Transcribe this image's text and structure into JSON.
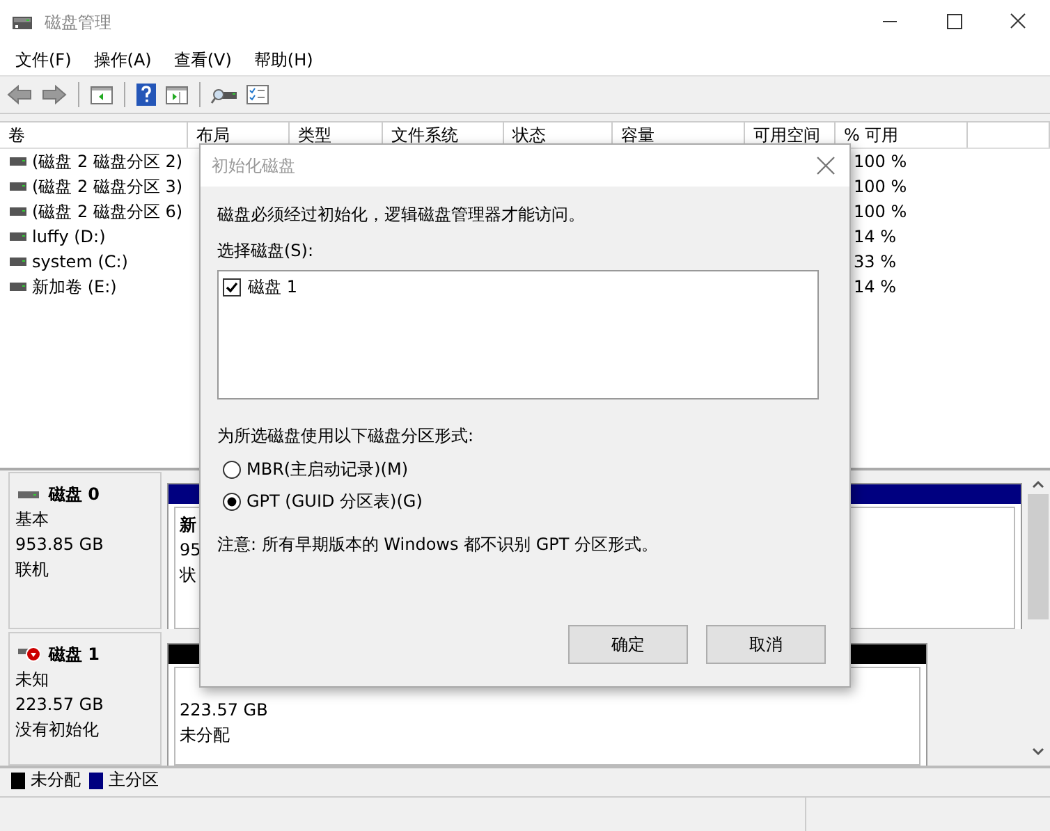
{
  "window": {
    "title": "磁盘管理"
  },
  "menu": [
    "文件(F)",
    "操作(A)",
    "查看(V)",
    "帮助(H)"
  ],
  "volumes": {
    "columns": [
      "卷",
      "布局",
      "类型",
      "文件系统",
      "状态",
      "容量",
      "可用空间",
      "% 可用"
    ],
    "rows": [
      {
        "name": "(磁盘 2 磁盘分区 2)",
        "free_percent": "100 %"
      },
      {
        "name": "(磁盘 2 磁盘分区 3)",
        "free_percent": "100 %"
      },
      {
        "name": "(磁盘 2 磁盘分区 6)",
        "free_percent": "100 %"
      },
      {
        "name": "luffy (D:)",
        "free_percent": "14 %"
      },
      {
        "name": "system (C:)",
        "free_percent": "33 %"
      },
      {
        "name": "新加卷 (E:)",
        "free_percent": "14 %"
      }
    ]
  },
  "disks": [
    {
      "name": "磁盘 0",
      "type": "基本",
      "size": "953.85 GB",
      "status": "联机",
      "error": false,
      "partitions": [
        {
          "color": "#000080",
          "name": "新",
          "size": "95",
          "status": "状"
        }
      ]
    },
    {
      "name": "磁盘 1",
      "type": "未知",
      "size": "223.57 GB",
      "status": "没有初始化",
      "error": true,
      "partitions": [
        {
          "color": "#000000",
          "size": "223.57 GB",
          "status": "未分配"
        }
      ]
    }
  ],
  "legend": [
    {
      "label": "未分配",
      "color": "#000000"
    },
    {
      "label": "主分区",
      "color": "#000080"
    }
  ],
  "dialog": {
    "title": "初始化磁盘",
    "message": "磁盘必须经过初始化，逻辑磁盘管理器才能访问。",
    "list_label": "选择磁盘(S):",
    "disks": [
      {
        "label": "磁盘 1",
        "checked": true
      }
    ],
    "style_label": "为所选磁盘使用以下磁盘分区形式:",
    "options": [
      {
        "label": "MBR(主启动记录)(M)",
        "selected": false
      },
      {
        "label": "GPT (GUID 分区表)(G)",
        "selected": true
      }
    ],
    "note": "注意: 所有早期版本的 Windows 都不识别 GPT 分区形式。",
    "buttons": [
      "确定",
      "取消"
    ]
  }
}
